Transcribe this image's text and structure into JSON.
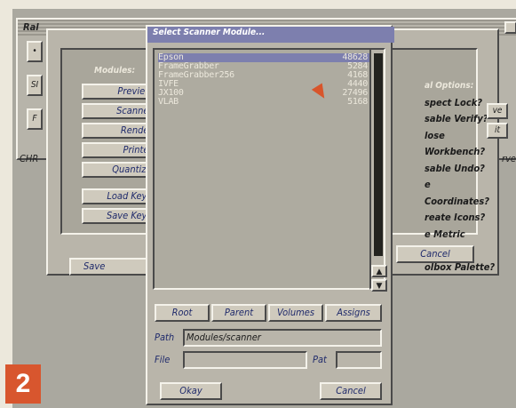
{
  "background_window": {
    "label": "Ral",
    "side_tabs": [
      "•",
      "SI",
      "F"
    ],
    "status_left": "CHR",
    "right_fragment": "rved"
  },
  "prefs_dialog": {
    "modules_label": "Modules:",
    "buttons": [
      "Preview...",
      "Scanner...",
      "Render...",
      "Printer...",
      "Quantize...",
      "Load Keys...",
      "Save Keys..."
    ],
    "save_label": "Save",
    "cancel_label": "Cancel",
    "options_head": "al Options:",
    "options": [
      "spect Lock?",
      "sable Verify?",
      "lose Workbench?",
      "sable Undo?",
      "e Coordinates?",
      "reate Icons?",
      "e Metric Units?",
      "olbox Palette?"
    ],
    "right_side_buttons": [
      "ve",
      "it"
    ]
  },
  "file_requester": {
    "title": "Select Scanner Module...",
    "entries": [
      {
        "name": "Epson",
        "size": "48628",
        "selected": true
      },
      {
        "name": "FrameGrabber",
        "size": "5284",
        "selected": false
      },
      {
        "name": "FrameGrabber256",
        "size": "4168",
        "selected": false
      },
      {
        "name": "IVFE",
        "size": "4440",
        "selected": false
      },
      {
        "name": "JX100",
        "size": "27496",
        "selected": false
      },
      {
        "name": "VLAB",
        "size": "5168",
        "selected": false
      }
    ],
    "buttons": {
      "root": "Root",
      "parent": "Parent",
      "volumes": "Volumes",
      "assigns": "Assigns"
    },
    "path_label": "Path",
    "path_value": "Modules/scanner",
    "file_label": "File",
    "file_value": "",
    "pat_label": "Pat",
    "pat_value": "",
    "okay_label": "Okay",
    "cancel_label": "Cancel"
  },
  "badge": "2",
  "colors": {
    "titlebar": "#7d7fae",
    "badge": "#d8562e",
    "selection": "#7d7fae"
  },
  "icons": {
    "close": "close-gadget",
    "scroll_up": "arrow-up-icon",
    "scroll_down": "arrow-down-icon"
  }
}
